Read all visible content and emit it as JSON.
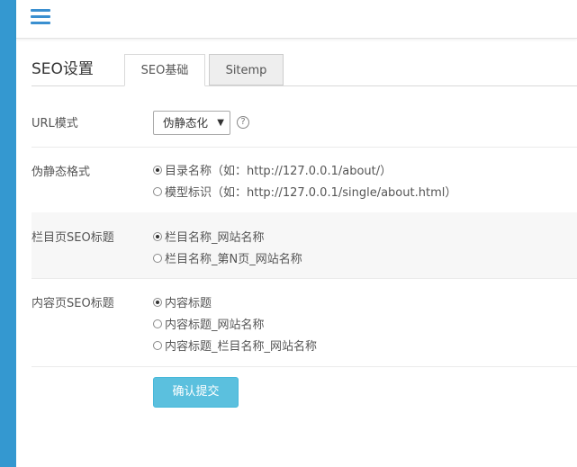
{
  "header": {
    "menu_icon": "hamburger-menu-icon"
  },
  "page": {
    "title": "SEO设置"
  },
  "tabs": [
    {
      "label": "SEO基础",
      "active": true
    },
    {
      "label": "Sitemp",
      "active": false
    }
  ],
  "form": {
    "url_mode": {
      "label": "URL模式",
      "selected": "伪静态化",
      "help_icon": "?"
    },
    "pseudo_static_format": {
      "label": "伪静态格式",
      "options": [
        "目录名称（如：http://127.0.0.1/about/）",
        "模型标识（如：http://127.0.0.1/single/about.html）"
      ],
      "selected_index": 0
    },
    "column_seo_title": {
      "label": "栏目页SEO标题",
      "options": [
        "栏目名称_网站名称",
        "栏目名称_第N页_网站名称"
      ],
      "selected_index": 0
    },
    "content_seo_title": {
      "label": "内容页SEO标题",
      "options": [
        "内容标题",
        "内容标题_网站名称",
        "内容标题_栏目名称_网站名称"
      ],
      "selected_index": 0
    },
    "submit_label": "确认提交"
  },
  "colors": {
    "sidebar": "#3498d0",
    "accent_button": "#5bc0de",
    "menu_icon": "#3a8fd0"
  }
}
